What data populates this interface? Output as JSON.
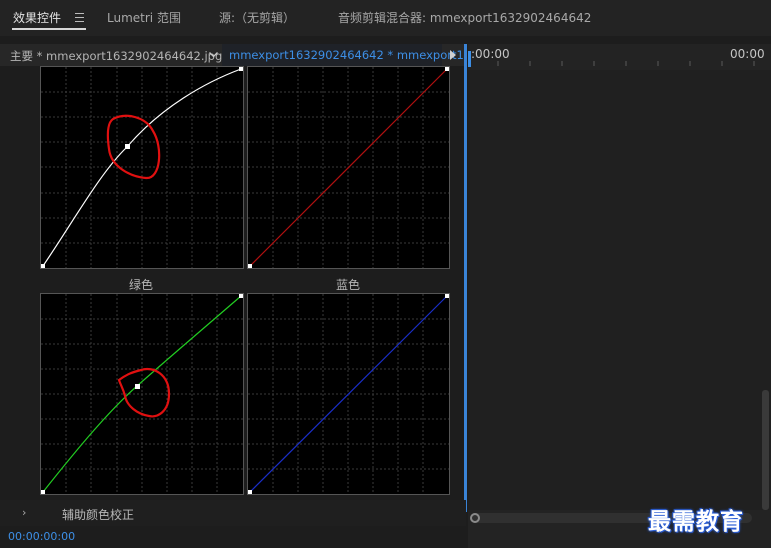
{
  "tabs": [
    {
      "label": "效果控件",
      "active": true
    },
    {
      "label": "Lumetri 范围",
      "active": false
    },
    {
      "label": "源:（无剪辑）",
      "active": false
    },
    {
      "label": "音频剪辑混合器: mmexport1632902464642",
      "active": false
    }
  ],
  "clip_header": {
    "master_clip": "主要 * mmexport1632902464642.jpg",
    "sequence_clip": "mmexport1632902464642 * mmexport1...",
    "dropdown_icon": "chevron-down-icon",
    "play_icon": "play-triangle-icon"
  },
  "curves": {
    "green_label": "绿色",
    "blue_label": "蓝色",
    "colors": {
      "luma": "#ffffff",
      "red": "#b01010",
      "green": "#22cc22",
      "blue": "#1a2ec8",
      "annotation": "#e01010"
    }
  },
  "assist_row": {
    "label": "辅助颜色校正",
    "chevron": "›"
  },
  "timecode": "00:00:00:00",
  "timeline": {
    "start_time": ":00:00",
    "end_time": "00:00"
  },
  "watermark": "最需教育"
}
